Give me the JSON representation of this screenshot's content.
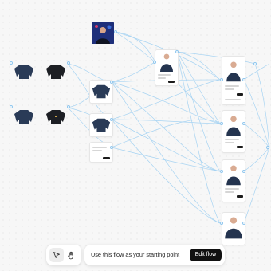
{
  "canvas": {
    "edge_color": "#9fd0f2",
    "port_color": "#8fc6ee",
    "sweater_color": "#24344f"
  },
  "toolbar": {
    "select_tool": "cursor-icon",
    "hand_tool": "hand-icon",
    "prompt_text": "Use this flow as your starting point",
    "edit_label": "Edit flow"
  }
}
